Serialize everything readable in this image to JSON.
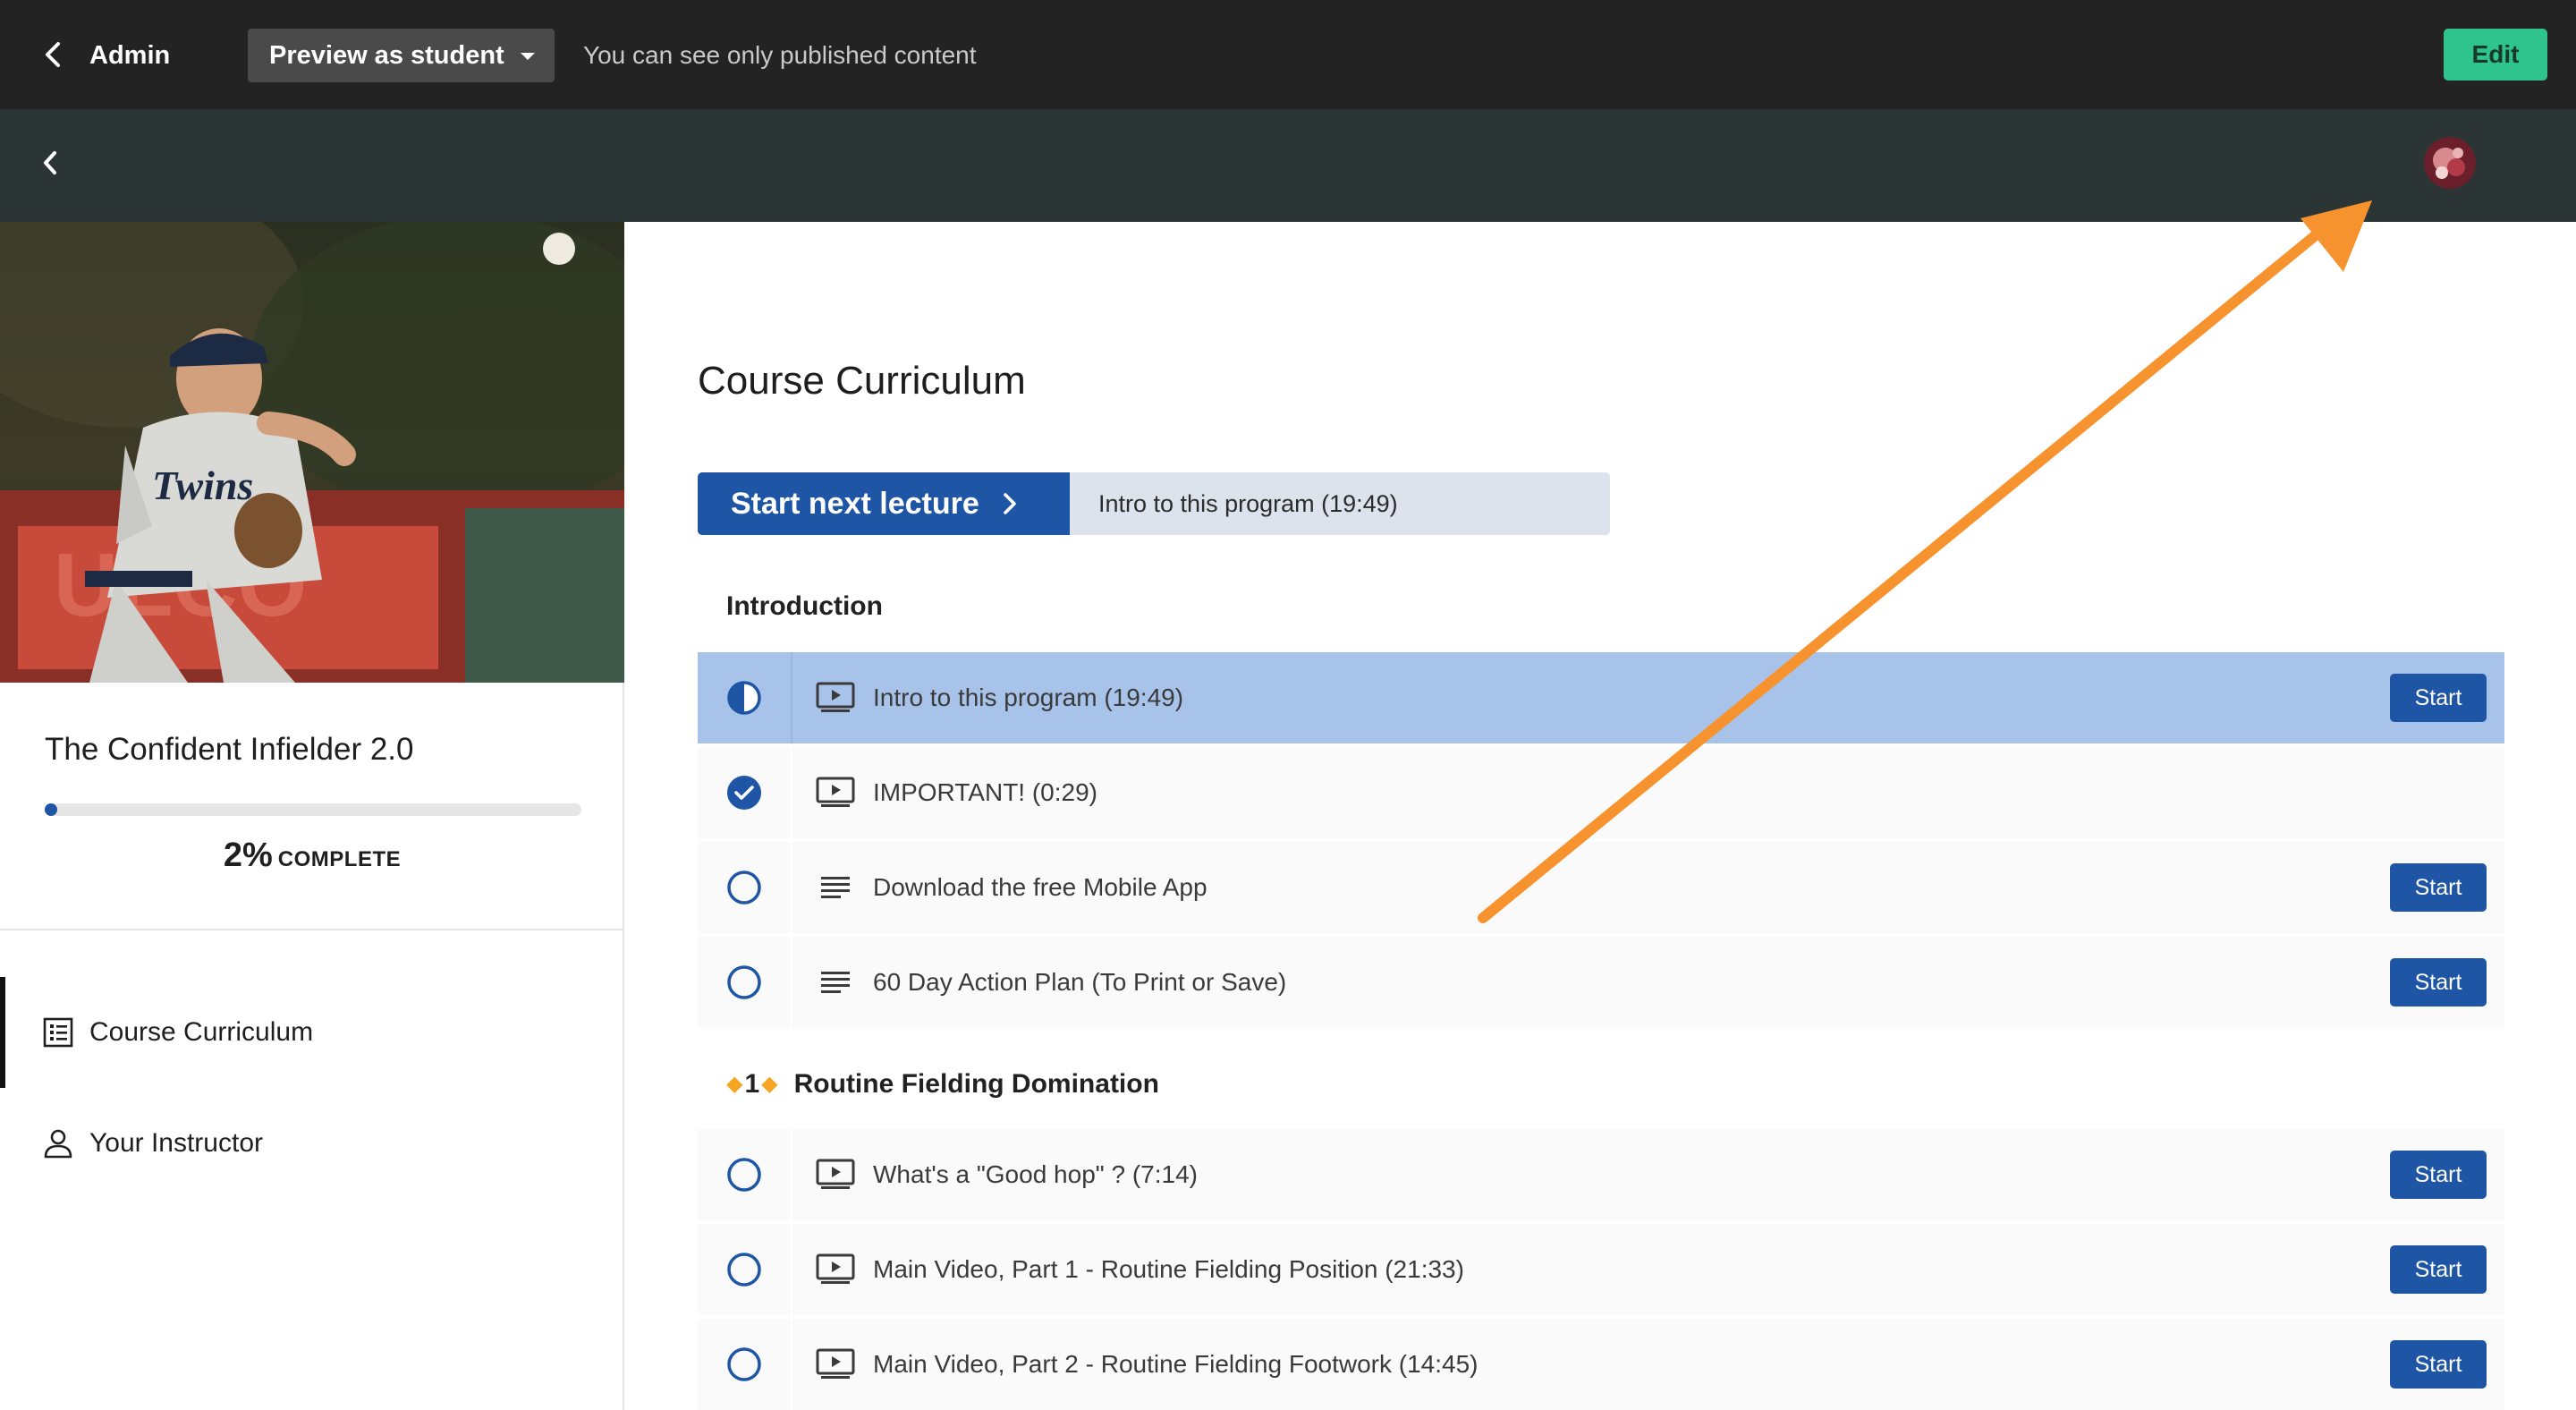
{
  "admin_bar": {
    "back_label": "Admin",
    "preview_label": "Preview as student",
    "preview_note": "You can see only published content",
    "edit_label": "Edit"
  },
  "course": {
    "title": "The Confident Infielder 2.0",
    "progress_percent_value": 0.02,
    "progress_percent": "2%",
    "progress_label": "COMPLETE"
  },
  "nav": [
    {
      "label": "Course Curriculum",
      "icon": "curriculum-list-icon",
      "active": true
    },
    {
      "label": "Your Instructor",
      "icon": "person-icon",
      "active": false
    }
  ],
  "main": {
    "title": "Course Curriculum",
    "next_button_label": "Start next lecture",
    "next_lecture_title": "Intro to this program (19:49)"
  },
  "sections": [
    {
      "title": "Introduction",
      "prefix": "",
      "lectures": [
        {
          "title": "Intro to this program (19:49)",
          "type": "video-icon",
          "status": "in-progress",
          "start_label": "Start"
        },
        {
          "title": "IMPORTANT! (0:29)",
          "type": "video-icon",
          "status": "completed",
          "start_label": ""
        },
        {
          "title": "Download the free Mobile App",
          "type": "text-lines-icon",
          "status": "not-started",
          "start_label": "Start"
        },
        {
          "title": "60 Day Action Plan (To Print or Save)",
          "type": "text-lines-icon",
          "status": "not-started",
          "start_label": "Start"
        }
      ]
    },
    {
      "title": "Routine Fielding Domination",
      "prefix": "1",
      "lectures": [
        {
          "title": "What's a \"Good hop\" ? (7:14)",
          "type": "video-icon",
          "status": "not-started",
          "start_label": "Start"
        },
        {
          "title": "Main Video, Part 1 - Routine Fielding Position (21:33)",
          "type": "video-icon",
          "status": "not-started",
          "start_label": "Start"
        },
        {
          "title": "Main Video, Part 2 - Routine Fielding Footwork (14:45)",
          "type": "video-icon",
          "status": "not-started",
          "start_label": "Start"
        }
      ]
    }
  ],
  "colors": {
    "brand_blue": "#1f55a5",
    "edit_green": "#2fc38e",
    "current_row": "#a8c3ea",
    "annotation_orange": "#f7932f",
    "section_diamond": "#f6a522"
  }
}
